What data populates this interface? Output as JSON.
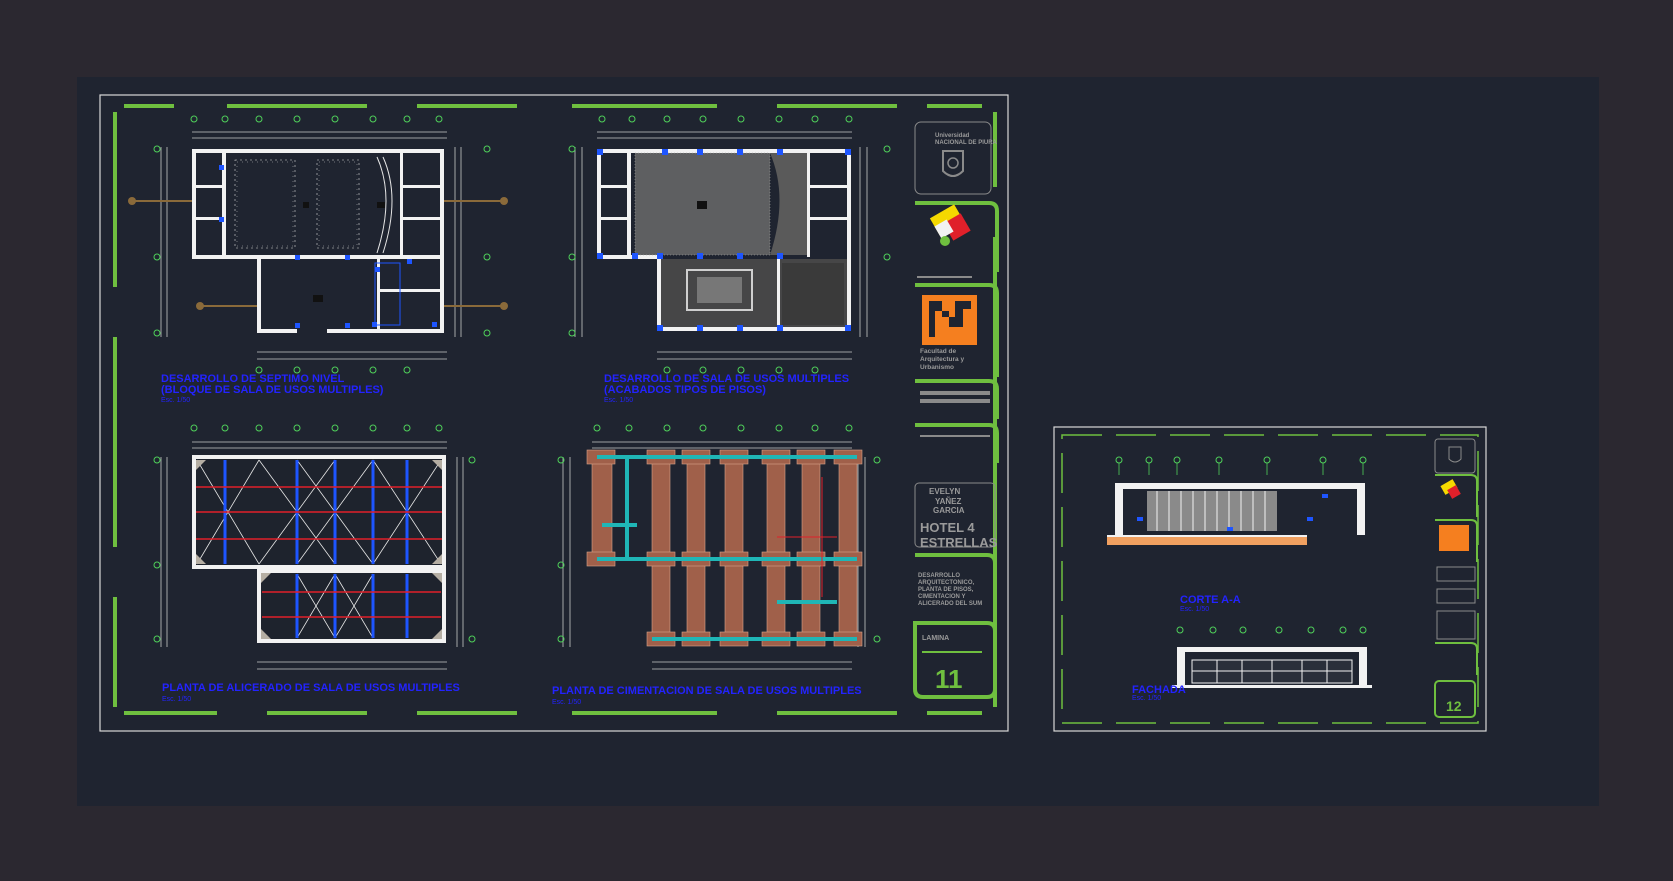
{
  "sheet1": {
    "plans": [
      {
        "title_line1": "DESARROLLO DE SEPTIMO NIVEL",
        "title_line2": "(BLOQUE DE SALA DE USOS MULTIPLES)",
        "scale": "Esc. 1/50"
      },
      {
        "title_line1": "DESARROLLO DE SALA DE USOS MULTIPLES",
        "title_line2": "(ACABADOS TIPOS DE PISOS)",
        "scale": "Esc. 1/50"
      },
      {
        "title_line1": "PLANTA DE ALICERADO DE SALA DE USOS MULTIPLES",
        "title_line2": "",
        "scale": "Esc. 1/50"
      },
      {
        "title_line1": "PLANTA DE CIMENTACION DE SALA DE USOS MULTIPLES",
        "title_line2": "",
        "scale": "Esc. 1/50"
      }
    ],
    "title_block": {
      "university_line1": "Universidad",
      "university_line2": "NACIONAL DE PIURA",
      "faculty_line1": "Facultad de",
      "faculty_line2": "Arquitectura y",
      "faculty_line3": "Urbanismo",
      "author_line1": "EVELYN",
      "author_line2": "YAÑEZ",
      "author_line3": "GARCIA",
      "project_line1": "HOTEL 4",
      "project_line2": "ESTRELLAS",
      "content_line1": "DESARROLLO",
      "content_line2": "ARQUITECTONICO,",
      "content_line3": "PLANTA DE PISOS,",
      "content_line4": "CIMENTACION Y",
      "content_line5": "ALICERADO DEL SUM",
      "sheet_label": "LAMINA",
      "sheet_number": "11"
    }
  },
  "sheet2": {
    "elevations": [
      {
        "title": "CORTE A-A",
        "scale": "Esc. 1/50"
      },
      {
        "title": "FACHADA",
        "scale": "Esc. 1/50"
      }
    ],
    "title_block": {
      "sheet_number": "12"
    }
  },
  "colors": {
    "background": "#2b2830",
    "model_space": "#1f2430",
    "frame_green": "#6fbf3f",
    "annotation_blue": "#2323ff",
    "wall_white": "#f2f2f2",
    "column_blue": "#1e55ff",
    "beam_red": "#e0202a",
    "footing_brown": "#a0604a",
    "tie_beam_cyan": "#1fb6b6",
    "logo_orange": "#f57f1f"
  }
}
